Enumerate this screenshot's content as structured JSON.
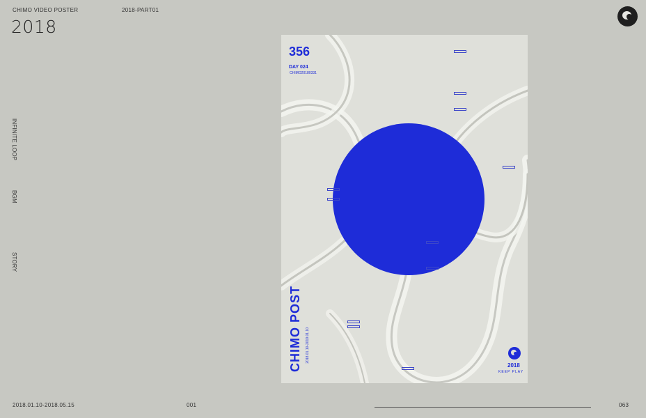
{
  "header": {
    "brand": "CHIMO VIDEO POSTER",
    "part": "2018-PART01",
    "year": "2018"
  },
  "nav": {
    "items": [
      "INFINITE LOOP",
      "BGM",
      "STORY"
    ]
  },
  "footer": {
    "dates": "2018.01.10-2018.05.15",
    "page_left": "001",
    "page_right": "063"
  },
  "poster": {
    "number": "356",
    "day": "DAY 024",
    "code": "CHIMO20180331",
    "title": "CHIMO POST",
    "dates": "2018.01.10-2019.01.10",
    "year": "2018",
    "tagline": "KEEP PLAY"
  },
  "icons": {
    "logo": "chimo-logo-icon"
  },
  "colors": {
    "background": "#c7c8c2",
    "poster_bg": "#dfe0da",
    "accent": "#1e2cd8",
    "logo": "#1f1f1f"
  }
}
